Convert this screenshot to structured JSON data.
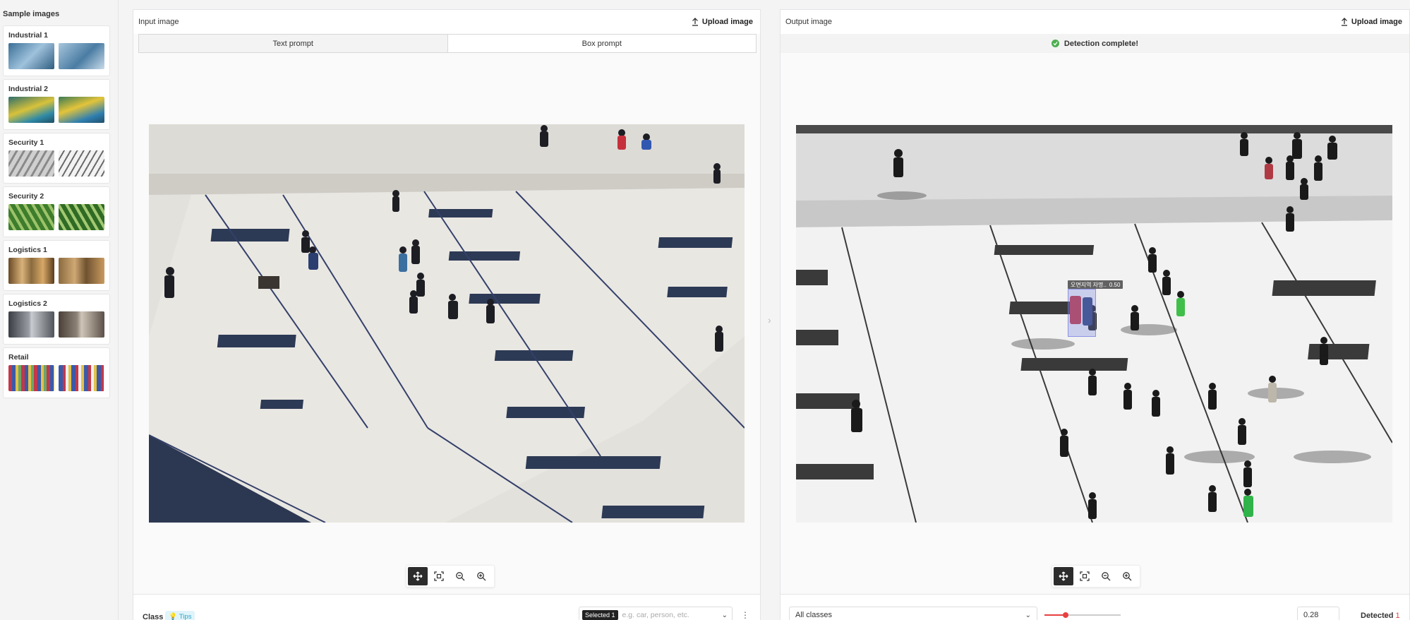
{
  "sidebar": {
    "title": "Sample images",
    "samples": [
      {
        "name": "Industrial 1"
      },
      {
        "name": "Industrial 2"
      },
      {
        "name": "Security 1"
      },
      {
        "name": "Security 2"
      },
      {
        "name": "Logistics 1"
      },
      {
        "name": "Logistics 2"
      },
      {
        "name": "Retail"
      }
    ]
  },
  "input_panel": {
    "title": "Input image",
    "upload_label": "Upload image",
    "tabs": [
      {
        "label": "Text prompt",
        "active": true
      },
      {
        "label": "Box prompt",
        "active": false
      }
    ],
    "footer": {
      "class_label": "Class",
      "tips_label": "Tips",
      "selected_chip": "Selected 1",
      "class_placeholder": "e.g. car, person, etc."
    }
  },
  "output_panel": {
    "title": "Output image",
    "upload_label": "Upload image",
    "status": "Detection complete!",
    "detection": {
      "label": "오면지역 자명..",
      "score": "0.50"
    },
    "footer": {
      "classes_value": "All classes",
      "threshold_value": "0.28",
      "threshold": 0.28,
      "detected_label": "Detected",
      "detected_count": "1"
    }
  },
  "colors": {
    "accent": "#e84040",
    "success": "#4caf50",
    "tips_bg": "#e0f4fa",
    "tips_text": "#2aa4c9"
  }
}
